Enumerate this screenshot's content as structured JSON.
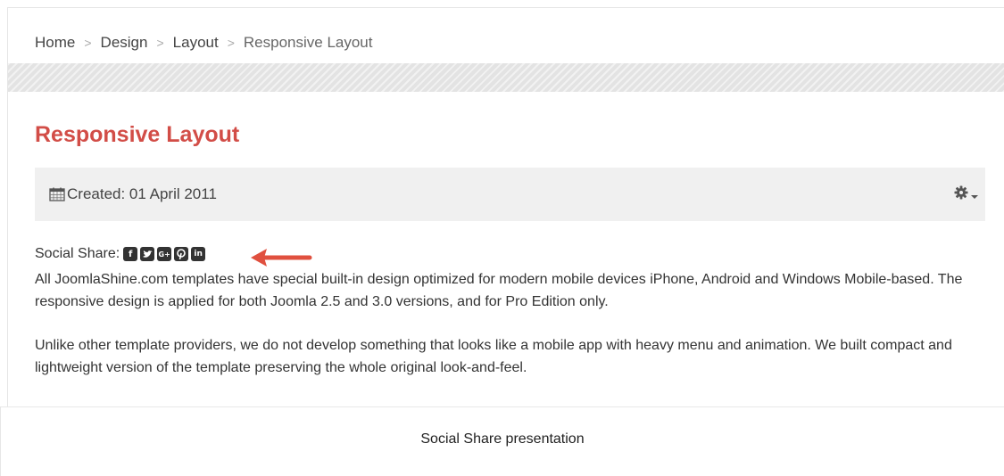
{
  "breadcrumb": {
    "items": [
      "Home",
      "Design",
      "Layout"
    ],
    "separator": ">",
    "current": "Responsive Layout"
  },
  "article": {
    "title": "Responsive Layout",
    "created": "Created: 01 April 2011",
    "social_label": "Social Share:",
    "social_icons": [
      "facebook-icon",
      "twitter-icon",
      "google-plus-icon",
      "pinterest-icon",
      "linkedin-icon"
    ],
    "paragraph1": "All JoomlaShine.com templates have special built-in design optimized for modern mobile devices iPhone, Android and Windows Mobile-based. The responsive design is applied for both Joomla 2.5 and 3.0 versions, and for Pro Edition only.",
    "paragraph2": "Unlike other template providers, we do not develop something that looks like a mobile app with heavy menu and animation. We built compact and lightweight version of the template preserving the whole original look-and-feel."
  },
  "caption": "Social Share presentation",
  "colors": {
    "title": "#d24d47",
    "arrow": "#e0503f",
    "meta_bg": "#f0f0f0"
  }
}
